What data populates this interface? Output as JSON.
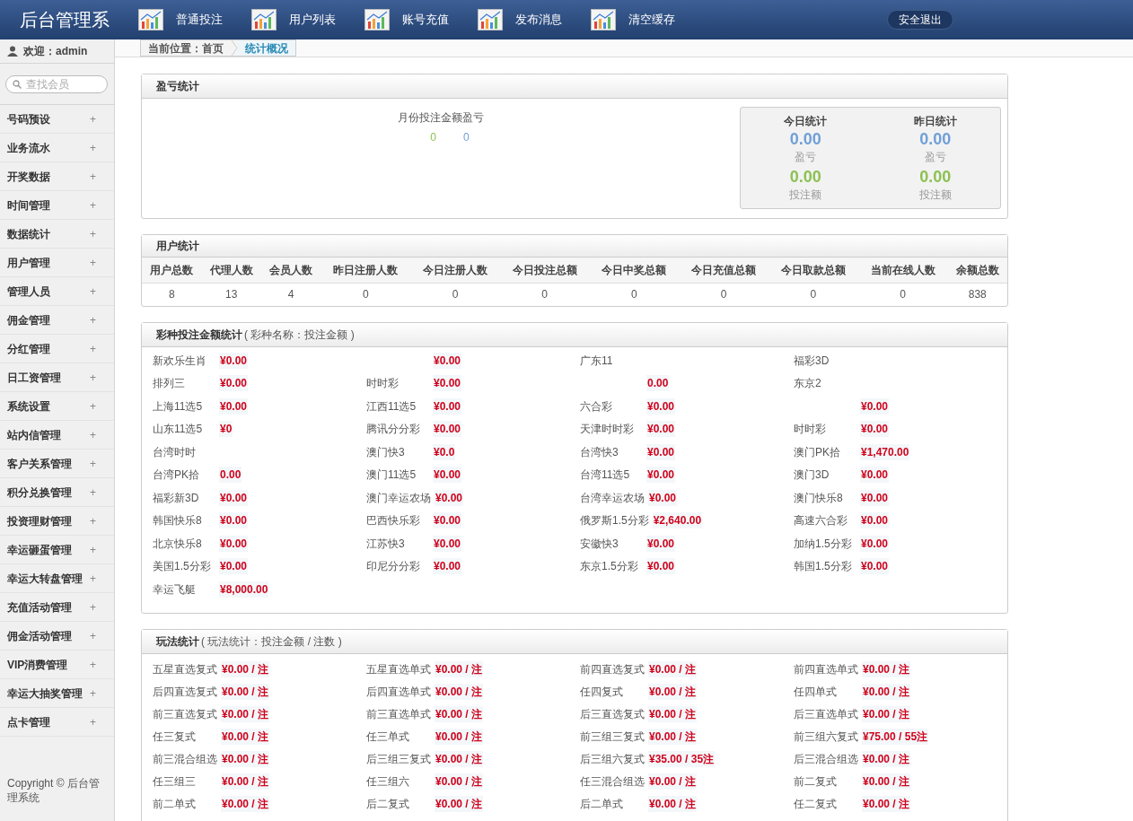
{
  "header": {
    "logo": "后台管理系",
    "nav": [
      {
        "label": "普通投注"
      },
      {
        "label": "用户列表"
      },
      {
        "label": "账号充值"
      },
      {
        "label": "发布消息"
      },
      {
        "label": "清空缓存"
      }
    ],
    "logout": "安全退出"
  },
  "sidebar": {
    "welcome": "欢迎：admin",
    "search_placeholder": "查找会员",
    "items": [
      "号码预设",
      "业务流水",
      "开奖数据",
      "时间管理",
      "数据统计",
      "用户管理",
      "管理人员",
      "佣金管理",
      "分红管理",
      "日工资管理",
      "系统设置",
      "站内信管理",
      "客户关系管理",
      "积分兑换管理",
      "投资理财管理",
      "幸运砸蛋管理",
      "幸运大转盘管理",
      "充值活动管理",
      "佣金活动管理",
      "VIP消费管理",
      "幸运大抽奖管理",
      "点卡管理"
    ],
    "expand_symbol": "+",
    "copyright": "Copyright © 后台管理系统"
  },
  "breadcrumb": [
    {
      "label": "当前位置：首页",
      "selected": false
    },
    {
      "label": "统计概况",
      "selected": true
    }
  ],
  "profit_panel": {
    "title": "盈亏统计",
    "chart_title": "月份投注金额盈亏",
    "legend": [
      {
        "label": "0",
        "color": "#8cc152"
      },
      {
        "label": "0",
        "color": "#6f9fd8"
      }
    ],
    "summary": [
      {
        "title": "今日统计",
        "profit": "0.00",
        "profit_label": "盈亏",
        "bet": "0.00",
        "bet_label": "投注额"
      },
      {
        "title": "昨日统计",
        "profit": "0.00",
        "profit_label": "盈亏",
        "bet": "0.00",
        "bet_label": "投注额"
      }
    ]
  },
  "user_panel": {
    "title": "用户统计",
    "columns": [
      "用户总数",
      "代理人数",
      "会员人数",
      "昨日注册人数",
      "今日注册人数",
      "今日投注总额",
      "今日中奖总额",
      "今日充值总额",
      "今日取款总额",
      "当前在线人数",
      "余额总数"
    ],
    "values": [
      "8",
      "13",
      "4",
      "0",
      "0",
      "0",
      "0",
      "0",
      "0",
      "0",
      "838"
    ]
  },
  "lottery_panel": {
    "title": "彩种投注金额统计",
    "subtitle": "( 彩种名称：投注金额 )",
    "items": [
      {
        "name": "新欢乐生肖",
        "value": "¥0.00"
      },
      {
        "value": "¥0.00"
      },
      {
        "name": "广东11"
      },
      {
        "name": "福彩3D"
      },
      {
        "name": "排列三",
        "value": "¥0.00"
      },
      {
        "name": "时时彩",
        "value": "¥0.00"
      },
      {
        "value": "0.00"
      },
      {
        "name": "东京2"
      },
      {
        "name": "上海11选5",
        "value": "¥0.00"
      },
      {
        "name": "江西11选5",
        "value": "¥0.00"
      },
      {
        "name": "六合彩",
        "value": "¥0.00"
      },
      {
        "value": "¥0.00"
      },
      {
        "name": "山东11选5",
        "value": "¥0"
      },
      {
        "name": "腾讯分分彩",
        "value": "¥0.00"
      },
      {
        "name": "天津时时彩",
        "value": "¥0.00"
      },
      {
        "name": "时时彩",
        "value": "¥0.00"
      },
      {
        "name": "台湾时时"
      },
      {
        "name": "澳门快3",
        "value": "¥0.0"
      },
      {
        "name": "台湾快3",
        "value": "¥0.00"
      },
      {
        "name": "澳门PK拾",
        "value": "¥1,470.00"
      },
      {
        "name": "台湾PK拾",
        "value": "0.00"
      },
      {
        "name": "澳门11选5",
        "value": "¥0.00"
      },
      {
        "name": "台湾11选5",
        "value": "¥0.00"
      },
      {
        "name": "澳门3D",
        "value": "¥0.00"
      },
      {
        "name": "福彩新3D",
        "value": "¥0.00"
      },
      {
        "name": "澳门幸运农场",
        "value": "¥0.00"
      },
      {
        "name": "台湾幸运农场",
        "value": "¥0.00"
      },
      {
        "name": "澳门快乐8",
        "value": "¥0.00"
      },
      {
        "name": "韩国快乐8",
        "value": "¥0.00"
      },
      {
        "name": "巴西快乐彩",
        "value": "¥0.00"
      },
      {
        "name": "俄罗斯1.5分彩",
        "value": "¥2,640.00"
      },
      {
        "name": "高速六合彩",
        "value": "¥0.00"
      },
      {
        "name": "北京快乐8",
        "value": "¥0.00"
      },
      {
        "name": "江苏快3",
        "value": "¥0.00"
      },
      {
        "name": "安徽快3",
        "value": "¥0.00"
      },
      {
        "name": "加纳1.5分彩",
        "value": "¥0.00"
      },
      {
        "name": "美国1.5分彩",
        "value": "¥0.00"
      },
      {
        "name": "印尼分分彩",
        "value": "¥0.00"
      },
      {
        "name": "东京1.5分彩",
        "value": "¥0.00"
      },
      {
        "name": "韩国1.5分彩",
        "value": "¥0.00"
      },
      {
        "name": "幸运飞艇",
        "value": "¥8,000.00"
      }
    ]
  },
  "play_panel": {
    "title": "玩法统计",
    "subtitle": "( 玩法统计：投注金额 / 注数 )",
    "items": [
      {
        "name": "五星直选复式",
        "value": "¥0.00 / 注"
      },
      {
        "name": "五星直选单式",
        "value": "¥0.00 / 注"
      },
      {
        "name": "前四直选复式",
        "value": "¥0.00 / 注"
      },
      {
        "name": "前四直选单式",
        "value": "¥0.00 / 注"
      },
      {
        "name": "后四直选复式",
        "value": "¥0.00 / 注"
      },
      {
        "name": "后四直选单式",
        "value": "¥0.00 / 注"
      },
      {
        "name": "任四复式",
        "value": "¥0.00 / 注"
      },
      {
        "name": "任四单式",
        "value": "¥0.00 / 注"
      },
      {
        "name": "前三直选复式",
        "value": "¥0.00 / 注"
      },
      {
        "name": "前三直选单式",
        "value": "¥0.00 / 注"
      },
      {
        "name": "后三直选复式",
        "value": "¥0.00 / 注"
      },
      {
        "name": "后三直选单式",
        "value": "¥0.00 / 注"
      },
      {
        "name": "任三复式",
        "value": "¥0.00 / 注"
      },
      {
        "name": "任三单式",
        "value": "¥0.00 / 注"
      },
      {
        "name": "前三组三复式",
        "value": "¥0.00 / 注"
      },
      {
        "name": "前三组六复式",
        "value": "¥75.00 / 55注"
      },
      {
        "name": "前三混合组选",
        "value": "¥0.00 / 注"
      },
      {
        "name": "后三组三复式",
        "value": "¥0.00 / 注"
      },
      {
        "name": "后三组六复式",
        "value": "¥35.00 / 35注"
      },
      {
        "name": "后三混合组选",
        "value": "¥0.00 / 注"
      },
      {
        "name": "任三组三",
        "value": "¥0.00 / 注"
      },
      {
        "name": "任三组六",
        "value": "¥0.00 / 注"
      },
      {
        "name": "任三混合组选",
        "value": "¥0.00 / 注"
      },
      {
        "name": "前二复式",
        "value": "¥0.00 / 注"
      },
      {
        "name": "前二单式",
        "value": "¥0.00 / 注"
      },
      {
        "name": "后二复式",
        "value": "¥0.00 / 注"
      },
      {
        "name": "后二单式",
        "value": "¥0.00 / 注"
      },
      {
        "name": "任二复式",
        "value": "¥0.00 / 注"
      }
    ]
  }
}
